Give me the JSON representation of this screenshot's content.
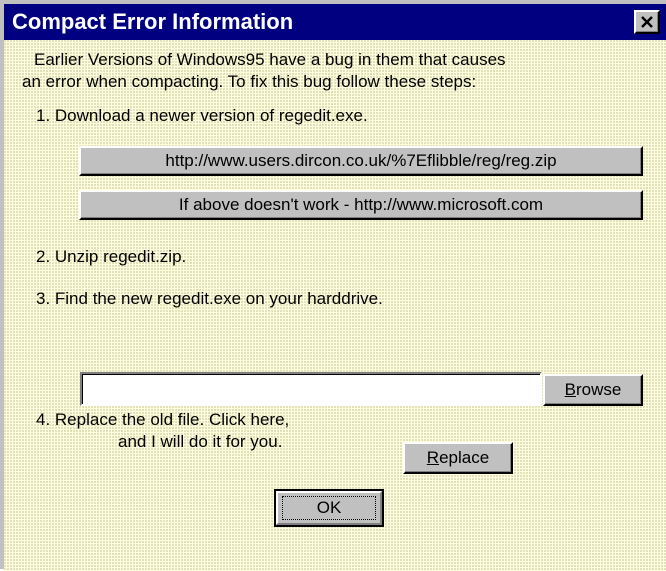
{
  "window": {
    "title": "Compact Error Information",
    "close_symbol": "close-icon"
  },
  "intro": {
    "line1": "Earlier Versions of Windows95 have a bug in them that causes",
    "line2": "an error when compacting.  To fix this bug follow these steps:"
  },
  "steps": {
    "step1": "1.  Download a newer version of regedit.exe.",
    "download_button": "http://www.users.dircon.co.uk/%7Eflibble/reg/reg.zip",
    "fallback_button": "If above doesn't work - http://www.microsoft.com",
    "step2": "2.  Unzip regedit.zip.",
    "step3": "3.  Find the new regedit.exe on your harddrive.",
    "path_value": "",
    "browse_button": {
      "accel": "B",
      "rest": "rowse"
    },
    "step4_line1": "4.  Replace the old file.  Click here,",
    "step4_line2": "and I will do it for you.",
    "replace_button": {
      "accel": "R",
      "rest": "eplace"
    }
  },
  "ok_button": "OK",
  "colors": {
    "titlebar": "#000080",
    "client_background": "#ffffdf",
    "button_face": "#c0c0c0"
  }
}
